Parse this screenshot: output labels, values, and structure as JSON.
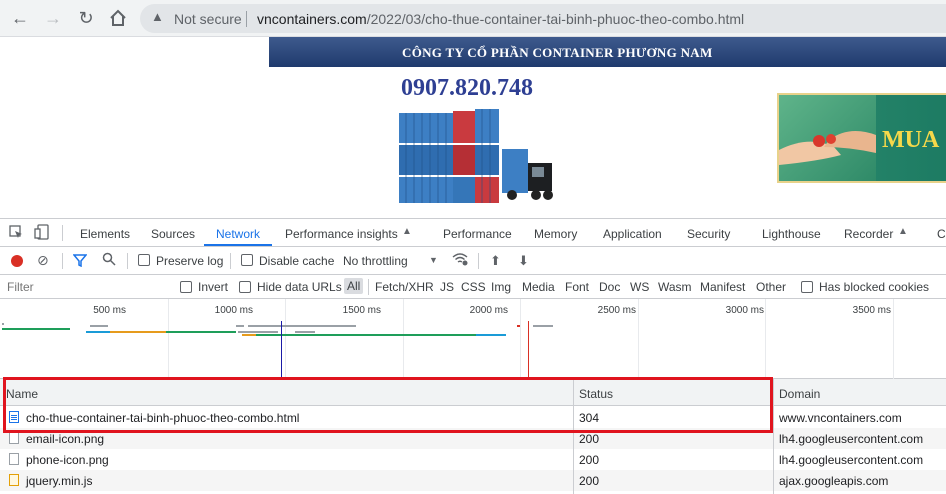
{
  "browser": {
    "security_label": "Not secure",
    "url_domain": "vncontainers.com",
    "url_path": "/2022/03/cho-thue-container-tai-binh-phuoc-theo-combo.html",
    "nav_icons": [
      "back-icon",
      "forward-icon",
      "reload-icon",
      "home-icon",
      "warning-icon"
    ]
  },
  "page": {
    "company_name": "CÔNG TY CỔ PHẦN CONTAINER PHƯƠNG NAM",
    "phone": "0907.820.748",
    "ad_text": "MUA",
    "colors": {
      "banner": "#2b4a80",
      "phone": "#2e3f93",
      "ad_bg": "#1c7a62",
      "ad_text": "#f6d84a"
    }
  },
  "devtools": {
    "tabs": [
      "Elements",
      "Sources",
      "Network",
      "Performance insights",
      "Performance",
      "Memory",
      "Application",
      "Security",
      "Lighthouse",
      "Recorder",
      "C"
    ],
    "active_tab": "Network",
    "toolbar": {
      "preserve_log": "Preserve log",
      "disable_cache": "Disable cache",
      "throttling": "No throttling"
    },
    "filter": {
      "placeholder": "Filter",
      "invert": "Invert",
      "hide_data_urls": "Hide data URLs",
      "types": [
        "All",
        "Fetch/XHR",
        "JS",
        "CSS",
        "Img",
        "Media",
        "Font",
        "Doc",
        "WS",
        "Wasm",
        "Manifest",
        "Other"
      ],
      "active_type": "All",
      "has_blocked_cookies": "Has blocked cookies"
    },
    "overview": {
      "ticks": [
        "500 ms",
        "1000 ms",
        "1500 ms",
        "2000 ms",
        "2500 ms",
        "3000 ms",
        "3500 ms"
      ],
      "colors": {
        "waiting": "#1e9e5a",
        "download": "#e69b1d",
        "request": "#1a9bd7",
        "queued": "#9aa0a6",
        "dom_content_loaded": "#1a1aa6",
        "load": "#d93025"
      }
    },
    "table": {
      "columns": [
        "Name",
        "Status",
        "Domain"
      ],
      "rows": [
        {
          "name": "cho-thue-container-tai-binh-phuoc-theo-combo.html",
          "status": "304",
          "domain": "www.vncontainers.com",
          "icon": "document-icon"
        },
        {
          "name": "email-icon.png",
          "status": "200",
          "domain": "lh4.googleusercontent.com",
          "icon": "image-file-icon"
        },
        {
          "name": "phone-icon.png",
          "status": "200",
          "domain": "lh4.googleusercontent.com",
          "icon": "image-file-icon"
        },
        {
          "name": "jquery.min.js",
          "status": "200",
          "domain": "ajax.googleapis.com",
          "icon": "script-file-icon"
        }
      ]
    },
    "highlight_color": "#e0141e"
  }
}
